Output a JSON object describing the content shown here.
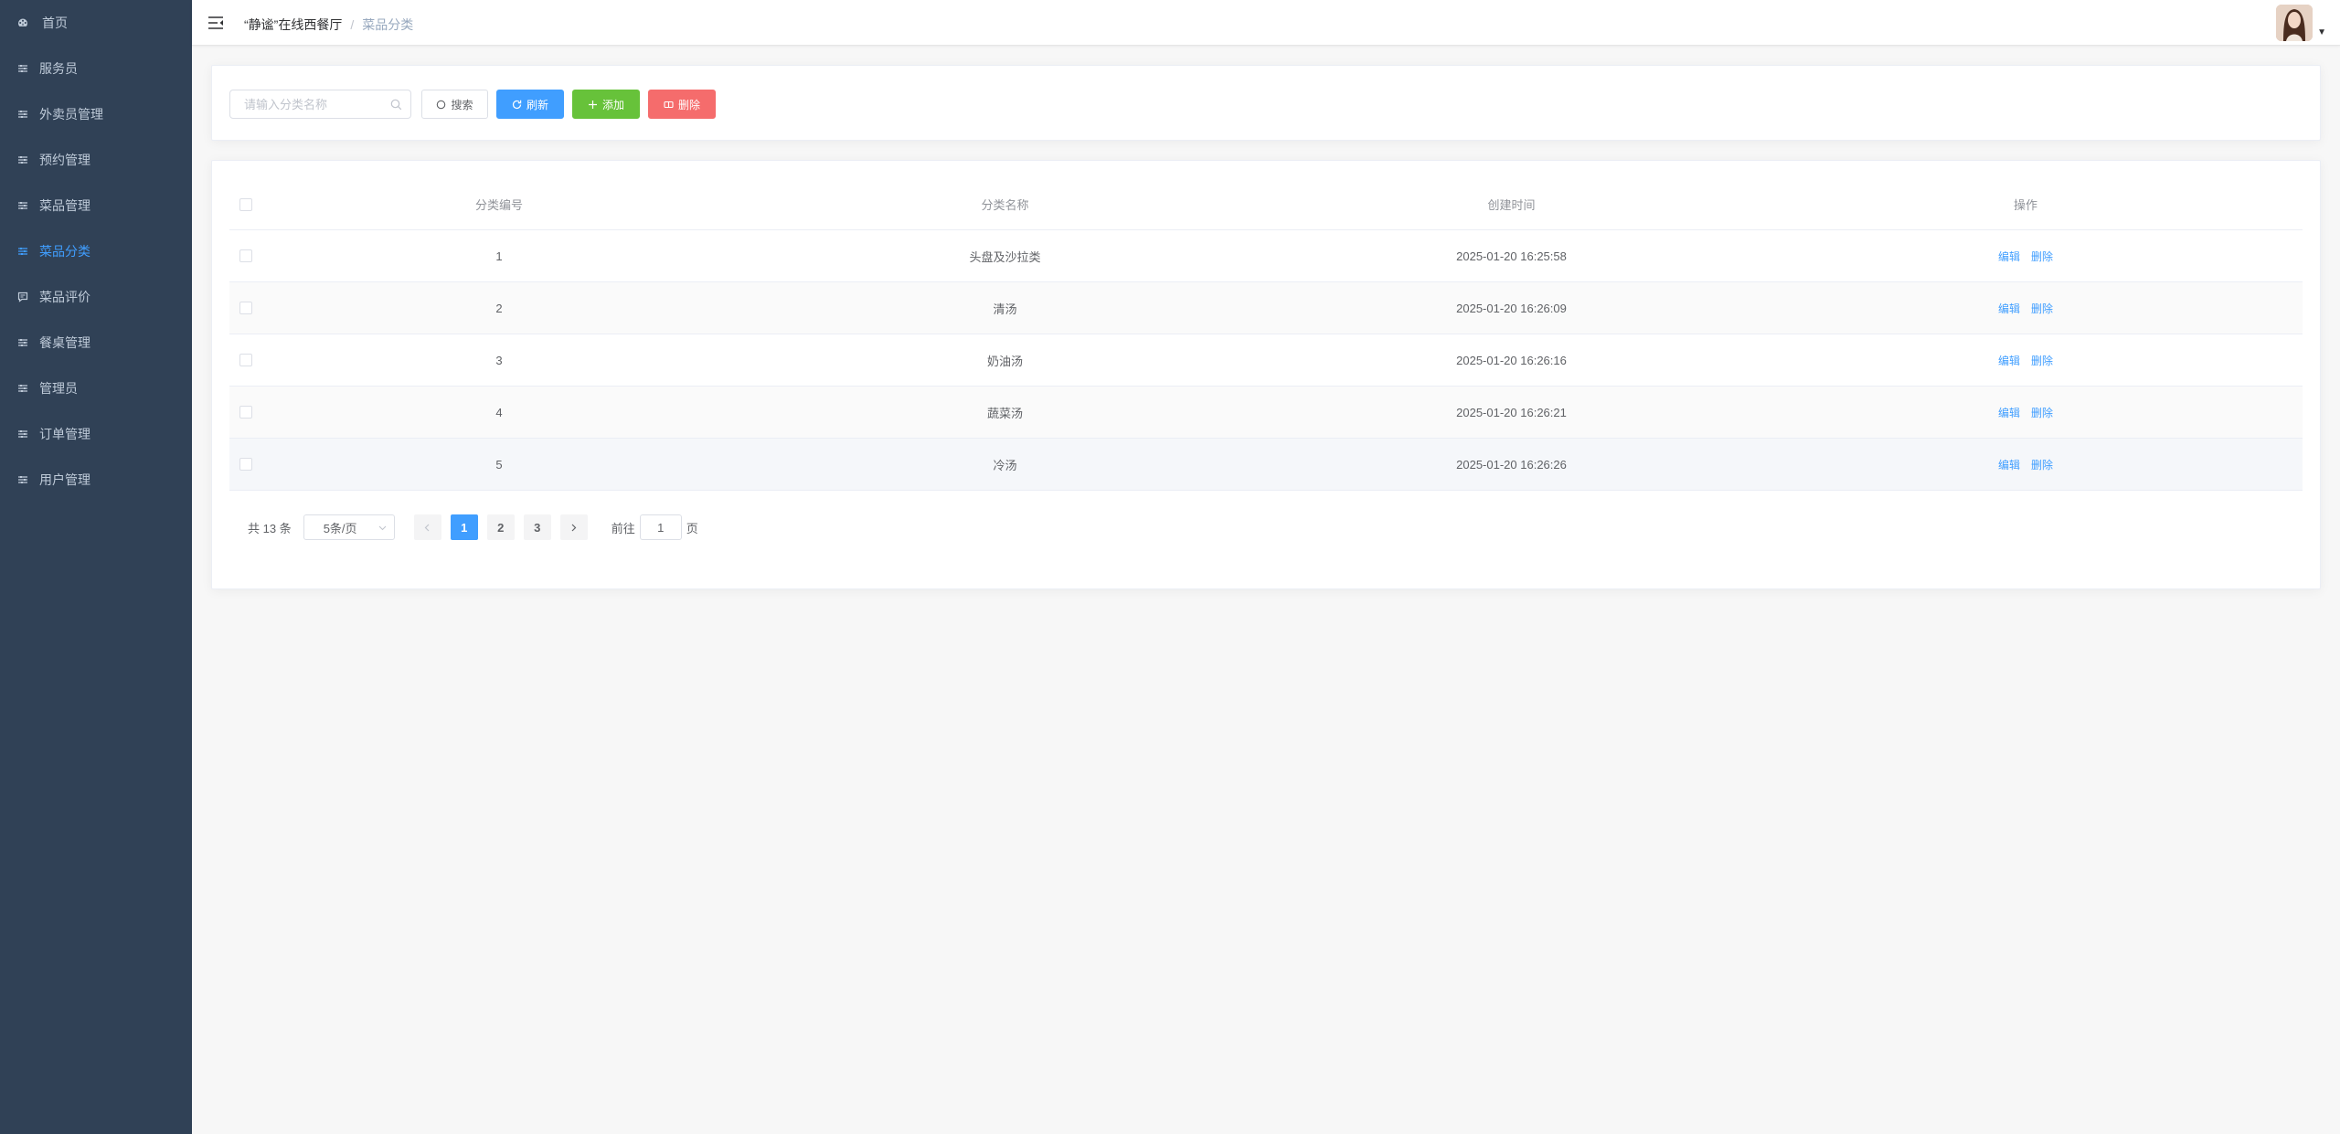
{
  "sidebar": {
    "items": [
      {
        "label": "首页",
        "icon": "dashboard-icon",
        "active": false
      },
      {
        "label": "服务员",
        "icon": "sliders-icon",
        "active": false
      },
      {
        "label": "外卖员管理",
        "icon": "sliders-icon",
        "active": false
      },
      {
        "label": "预约管理",
        "icon": "sliders-icon",
        "active": false
      },
      {
        "label": "菜品管理",
        "icon": "sliders-icon",
        "active": false
      },
      {
        "label": "菜品分类",
        "icon": "sliders-icon",
        "active": true
      },
      {
        "label": "菜品评价",
        "icon": "comment-icon",
        "active": false
      },
      {
        "label": "餐桌管理",
        "icon": "sliders-icon",
        "active": false
      },
      {
        "label": "管理员",
        "icon": "sliders-icon",
        "active": false
      },
      {
        "label": "订单管理",
        "icon": "sliders-icon",
        "active": false
      },
      {
        "label": "用户管理",
        "icon": "sliders-icon",
        "active": false
      }
    ]
  },
  "header": {
    "breadcrumb": {
      "home": "“静谧”在线西餐厅",
      "separator": "/",
      "current": "菜品分类"
    }
  },
  "toolbar": {
    "search_placeholder": "请输入分类名称",
    "search_label": "搜索",
    "refresh_label": "刷新",
    "add_label": "添加",
    "delete_label": "删除"
  },
  "table": {
    "columns": [
      "分类编号",
      "分类名称",
      "创建时间",
      "操作"
    ],
    "rows": [
      {
        "id": "1",
        "name": "头盘及沙拉类",
        "created": "2025-01-20 16:25:58"
      },
      {
        "id": "2",
        "name": "清汤",
        "created": "2025-01-20 16:26:09"
      },
      {
        "id": "3",
        "name": "奶油汤",
        "created": "2025-01-20 16:26:16"
      },
      {
        "id": "4",
        "name": "蔬菜汤",
        "created": "2025-01-20 16:26:21"
      },
      {
        "id": "5",
        "name": "冷汤",
        "created": "2025-01-20 16:26:26"
      }
    ],
    "edit_label": "编辑",
    "delete_label": "删除"
  },
  "pagination": {
    "total": "共 13 条",
    "page_size": "5条/页",
    "pages": [
      "1",
      "2",
      "3"
    ],
    "current_page": "1",
    "goto_prefix": "前往",
    "goto_value": "1",
    "goto_suffix": "页"
  },
  "colors": {
    "sidebar_bg": "#304156",
    "sidebar_text": "#bfcbd9",
    "primary": "#409eff",
    "success": "#67c23a",
    "danger": "#f56c6c"
  }
}
